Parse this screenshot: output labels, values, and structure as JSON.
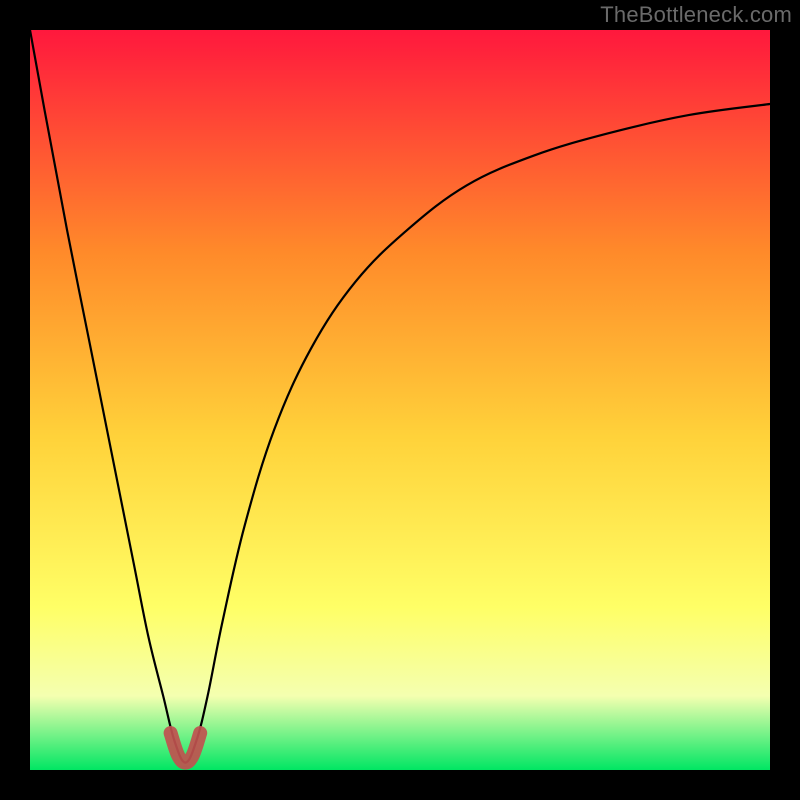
{
  "watermark": "TheBottleneck.com",
  "chart_data": {
    "type": "line",
    "title": "",
    "xlabel": "",
    "ylabel": "",
    "xlim": [
      0,
      100
    ],
    "ylim": [
      0,
      100
    ],
    "grid": false,
    "legend": false,
    "series": [
      {
        "name": "bottleneck-curve",
        "x": [
          0,
          2,
          5,
          8,
          11,
          14,
          16,
          18,
          19.5,
          21,
          22.5,
          24,
          26,
          29,
          33,
          38,
          44,
          51,
          59,
          68,
          78,
          89,
          100
        ],
        "y": [
          100,
          89,
          73,
          58,
          43,
          28,
          18,
          10,
          4,
          1,
          4,
          10,
          20,
          33,
          46,
          57,
          66,
          73,
          79,
          83,
          86,
          88.5,
          90
        ]
      },
      {
        "name": "highlight-min",
        "x": [
          19,
          20,
          21,
          22,
          23
        ],
        "y": [
          5,
          2,
          1,
          2,
          5
        ]
      }
    ],
    "colors": {
      "curve": "#000000",
      "highlight": "#c0514f",
      "gradient_top": "#ff183d",
      "gradient_mid_upper": "#ff8a2a",
      "gradient_mid": "#ffd23a",
      "gradient_mid_lower": "#ffff66",
      "gradient_lower": "#f4ffb0",
      "gradient_bottom": "#00e663"
    }
  }
}
